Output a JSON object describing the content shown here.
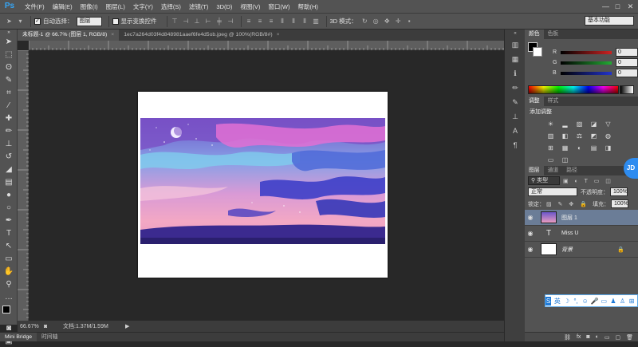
{
  "app": {
    "logo_text": "Ps"
  },
  "menu": [
    "文件(F)",
    "编辑(E)",
    "图像(I)",
    "图层(L)",
    "文字(Y)",
    "选择(S)",
    "滤镜(T)",
    "3D(D)",
    "视图(V)",
    "窗口(W)",
    "帮助(H)"
  ],
  "window_controls": {
    "minimize": "—",
    "restore": "□",
    "close": "✕"
  },
  "options": {
    "auto_select_label": "自动选择：",
    "auto_select_value": "图层",
    "show_transform_label": "显示变换控件",
    "mode_3d_label": "3D 模式：",
    "workspace_value": "基本功能"
  },
  "tabs": [
    {
      "label": "未标题-1 @ 66.7% (图层 1, RGB/8)",
      "close": "×",
      "active": true
    },
    {
      "label": "1ec7a264d03f4d848981aaef6fe4d5ob.jpeg @ 100%(RGB/8#)",
      "close": "×",
      "active": false
    }
  ],
  "status": {
    "zoom": "66.67%",
    "doc_size": "文档:1.37M/1.59M"
  },
  "bottom_tabs": [
    "Mini Bridge",
    "时间轴"
  ],
  "color_panel": {
    "tabs": [
      "颜色",
      "色板"
    ],
    "sliders": [
      {
        "label": "R",
        "value": "0",
        "color": "#cc2222"
      },
      {
        "label": "G",
        "value": "0",
        "color": "#22aa33"
      },
      {
        "label": "B",
        "value": "0",
        "color": "#2233cc"
      }
    ]
  },
  "adjust_panel": {
    "tabs": [
      "调整",
      "样式"
    ],
    "title": "添加调整",
    "icons": [
      "brightness-icon",
      "levels-icon",
      "curves-icon",
      "exposure-icon",
      "triangle-icon",
      "vibrance-icon",
      "hue-icon",
      "balance-icon",
      "bw-icon",
      "photo-filter-icon",
      "channel-mixer-icon",
      "color-lookup-icon",
      "invert-icon",
      "posterize-icon",
      "threshold-icon",
      "gradient-map-icon",
      "selective-color-icon"
    ]
  },
  "layers_panel": {
    "tabs": [
      "图层",
      "通道",
      "路径"
    ],
    "filter_kind": "类型",
    "blend_mode": "正常",
    "opacity_label": "不透明度：",
    "opacity_value": "100%",
    "lock_label": "锁定：",
    "fill_label": "填充：",
    "fill_value": "100%",
    "layers": [
      {
        "name": "图层 1",
        "type": "image",
        "selected": true
      },
      {
        "name": "Miss U",
        "type": "text",
        "selected": false
      },
      {
        "name": "背景",
        "type": "background",
        "selected": false
      }
    ]
  },
  "ime": {
    "lang": "英",
    "badge": "JD"
  }
}
